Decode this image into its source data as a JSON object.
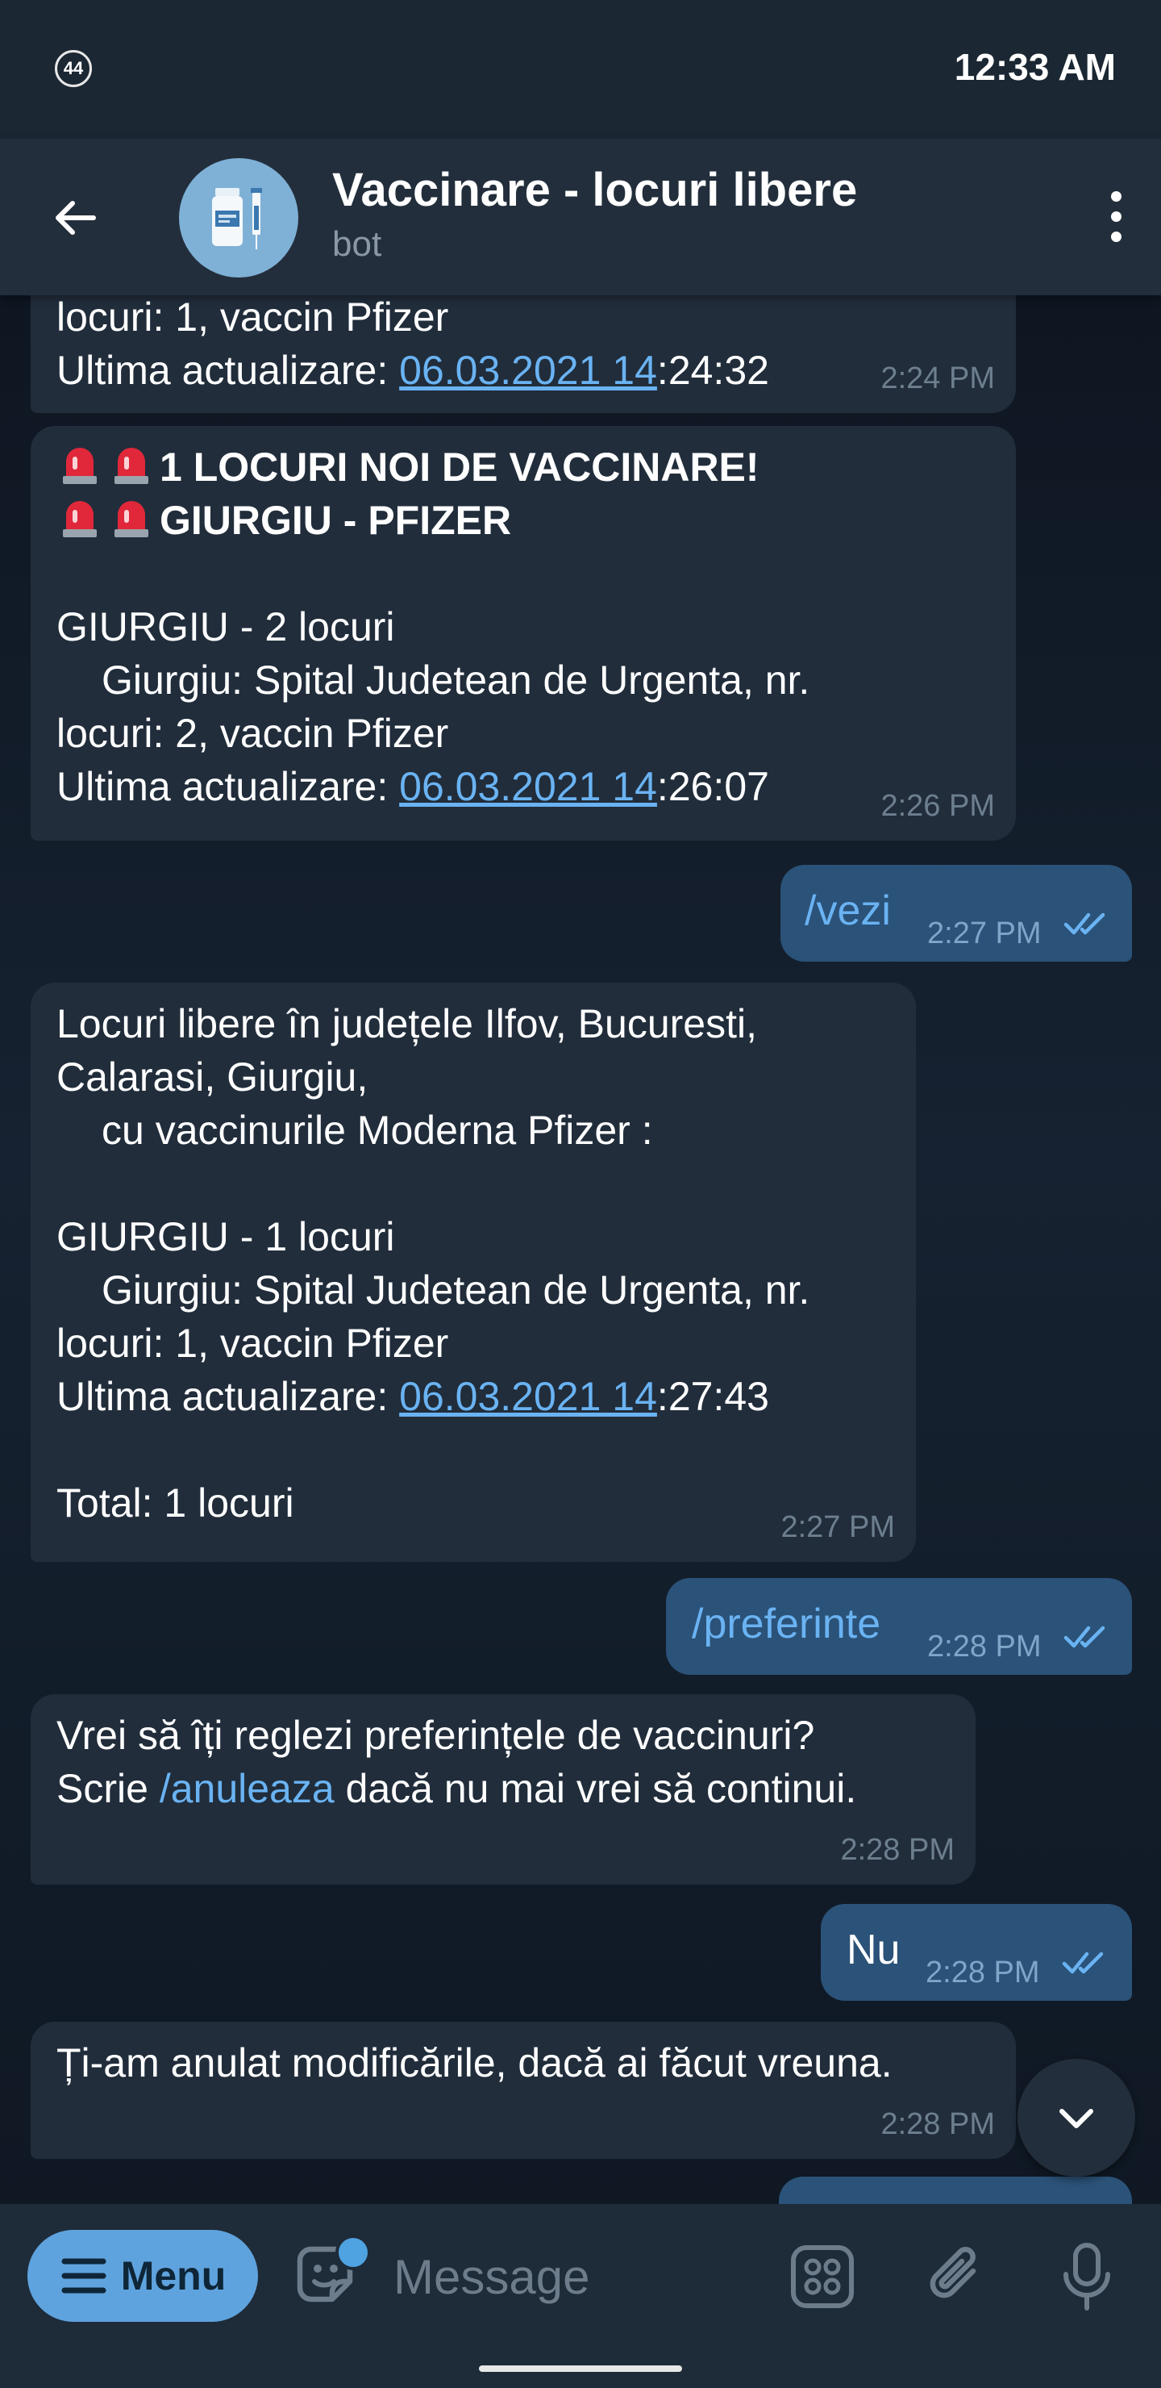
{
  "status_bar": {
    "notification_badge": "44",
    "time": "12:33 AM"
  },
  "header": {
    "title": "Vaccinare - locuri libere",
    "subtitle": "bot",
    "avatar_icon": "vaccine-vial-syringe-icon"
  },
  "messages": {
    "m1": {
      "line1": "locuri: 1, vaccin Pfizer",
      "line2_prefix": "Ultima actualizare: ",
      "line2_link": "06.03.2021 14",
      "line2_suffix": ":24:32",
      "time": "2:24 PM"
    },
    "m2": {
      "header1": "1 LOCURI NOI DE VACCINARE!",
      "header2": "GIURGIU - PFIZER",
      "line1": "GIURGIU - 2 locuri",
      "line2": "Giurgiu: Spital Judetean de Urgenta, nr.",
      "line3": "locuri: 2, vaccin Pfizer",
      "line4_prefix": "Ultima actualizare: ",
      "line4_link": "06.03.2021 14",
      "line4_suffix": ":26:07",
      "time": "2:26 PM"
    },
    "m3": {
      "text": "/vezi",
      "time": "2:27 PM"
    },
    "m4": {
      "line1": "Locuri libere în județele Ilfov, Bucuresti,",
      "line2": "Calarasi, Giurgiu,",
      "line3": "cu vaccinurile Moderna Pfizer :",
      "line4": "GIURGIU - 1 locuri",
      "line5": "Giurgiu: Spital Judetean de Urgenta, nr.",
      "line6": "locuri: 1, vaccin Pfizer",
      "line7_prefix": "Ultima actualizare: ",
      "line7_link": "06.03.2021 14",
      "line7_suffix": ":27:43",
      "line8": "Total: 1 locuri",
      "time": "2:27 PM"
    },
    "m5": {
      "text": "/preferinte",
      "time": "2:28 PM"
    },
    "m6": {
      "line1": "Vrei să îți reglezi preferințele de vaccinuri?",
      "line2_prefix": "Scrie ",
      "line2_link": "/anuleaza",
      "line2_suffix": " dacă nu mai vrei să continui.",
      "time": "2:28 PM"
    },
    "m7": {
      "text": "Nu",
      "time": "2:28 PM"
    },
    "m8": {
      "text": "Ți-am anulat modificările, dacă ai făcut vreuna.",
      "time": "2:28 PM"
    }
  },
  "input_bar": {
    "menu_label": "Menu",
    "placeholder": "Message"
  },
  "colors": {
    "background": "#0e1621",
    "incoming_bubble": "#212d3b",
    "outgoing_bubble": "#2b5278",
    "link": "#6ab3f3",
    "menu_button": "#5fa3de"
  }
}
